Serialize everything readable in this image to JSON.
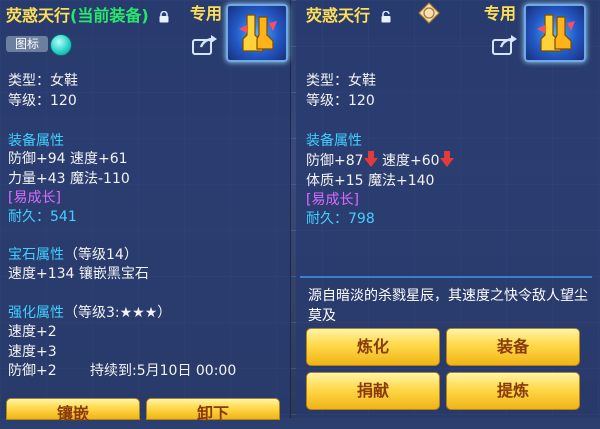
{
  "left": {
    "title_name": "荧惑天行",
    "title_tag": "(当前装备)",
    "special_label": "专用",
    "icon_toggle_label": "图标",
    "type": "类型：女鞋",
    "level": "等级：120",
    "equip_attr_header": "装备属性",
    "attr_line1": "防御+94 速度+61",
    "attr_line2": "力量+43 魔法-110",
    "growth_tag": "[易成长]",
    "durability_label": "耐久：",
    "durability_value": "541",
    "gem_header": "宝石属性",
    "gem_level": "（等级14）",
    "gem_line": "速度+134 镶嵌黑宝石",
    "enh_header": "强化属性",
    "enh_level": "（等级3:★★★）",
    "enh_line1": "速度+2",
    "enh_line2": "速度+3",
    "enh_line3": "防御+2",
    "enh_duration": "持续到:5月10日 00:00",
    "btn_inlay": "镶嵌",
    "btn_unequip": "卸下"
  },
  "right": {
    "title_name": "荧惑天行",
    "special_label": "专用",
    "type": "类型：女鞋",
    "level": "等级：120",
    "equip_attr_header": "装备属性",
    "attr_line1a": "防御+87",
    "attr_line1b": "速度+60",
    "attr_line2": "体质+15 魔法+140",
    "growth_tag": "[易成长]",
    "durability_label": "耐久：",
    "durability_value": "798",
    "description": "源自暗淡的杀戮星辰，其速度之快令敌人望尘莫及",
    "btn_refine": "炼化",
    "btn_equip": "装备",
    "btn_donate": "捐献",
    "btn_extract": "提炼"
  },
  "colors": {
    "title": "#ffdf55",
    "current_tag": "#27e86a",
    "section": "#3fd1ff",
    "growth": "#d96bff",
    "decrease_arrow": "#e23b3b"
  }
}
